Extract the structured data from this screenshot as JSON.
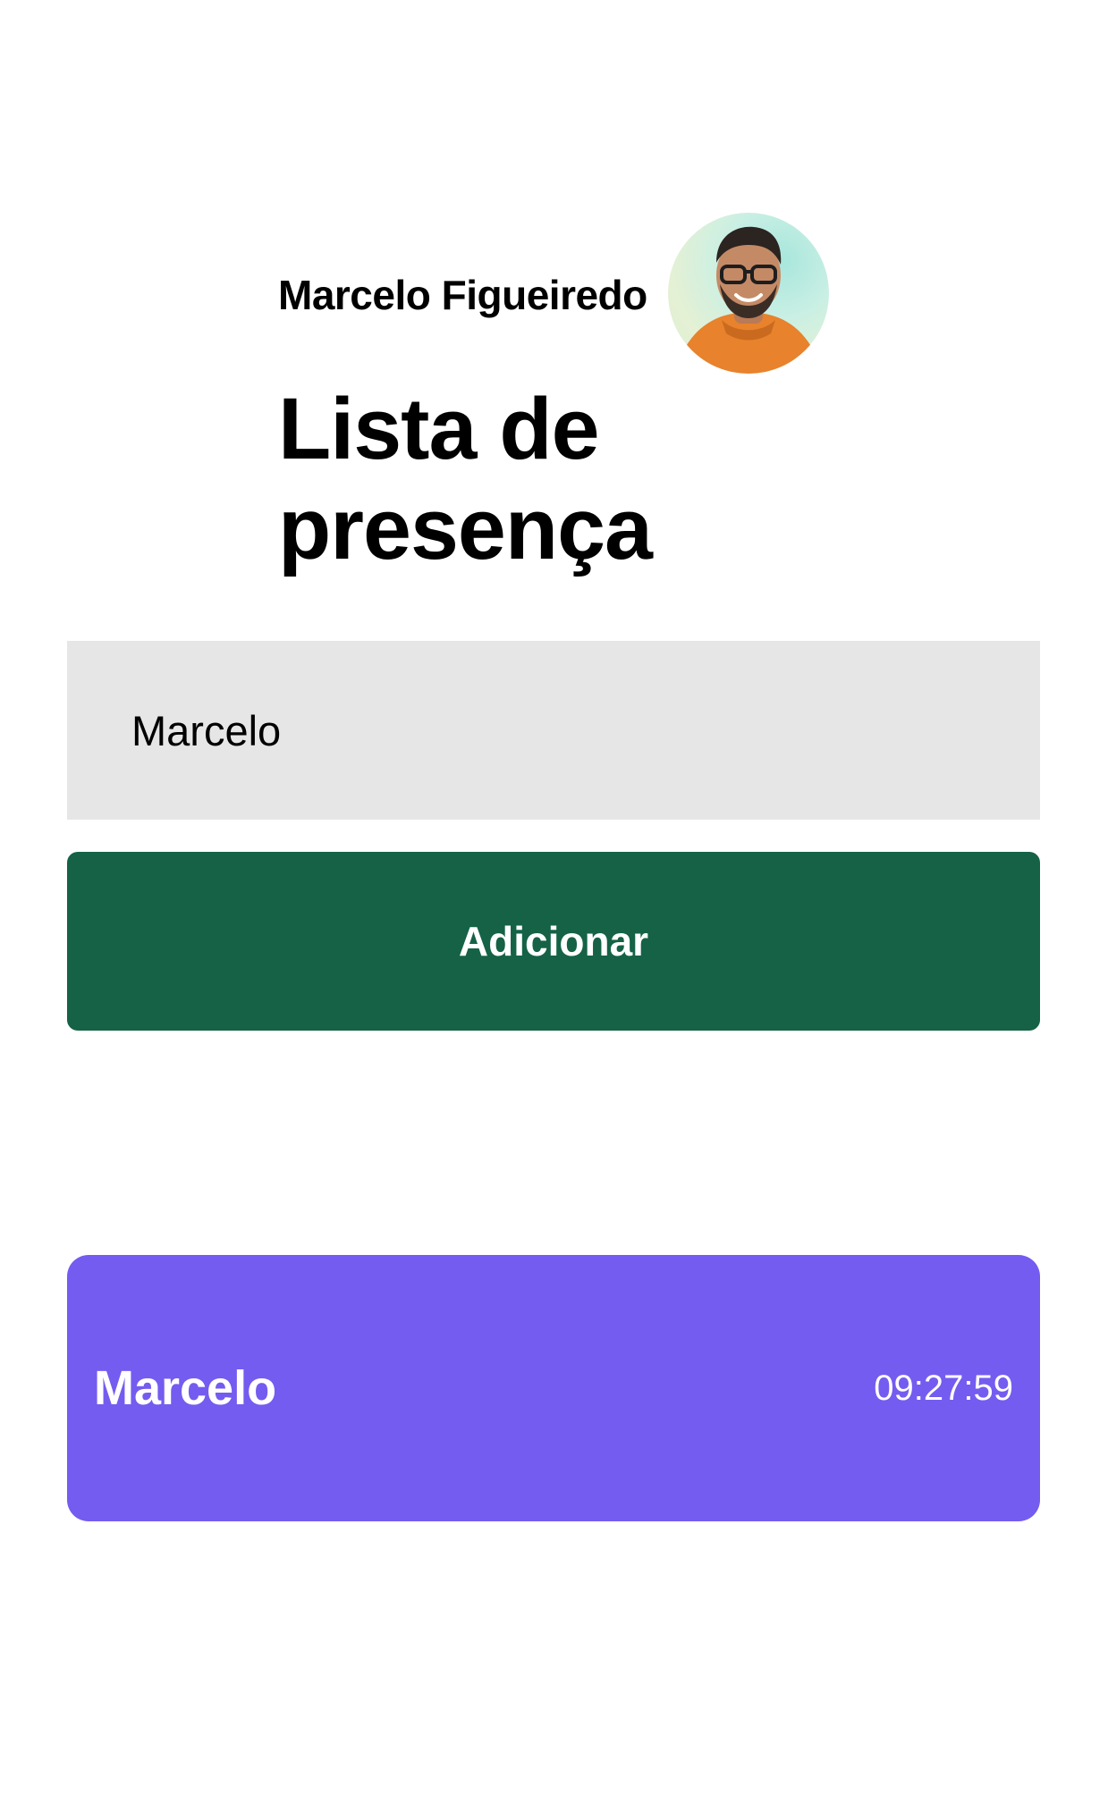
{
  "header": {
    "user_name": "Marcelo Figueiredo",
    "title": "Lista de presença"
  },
  "avatar": {
    "alt": "Foto de Marcelo Figueiredo",
    "icon": "user-photo"
  },
  "form": {
    "input_value": "Marcelo",
    "input_placeholder": "",
    "add_label": "Adicionar"
  },
  "attendees": [
    {
      "name": "Marcelo",
      "time": "09:27:59"
    }
  ],
  "colors": {
    "background": "#ffffff",
    "input_background": "#e6e6e6",
    "button": "#156246",
    "card": "#745cf0",
    "text_dark": "#000000",
    "text_light": "#ffffff"
  }
}
